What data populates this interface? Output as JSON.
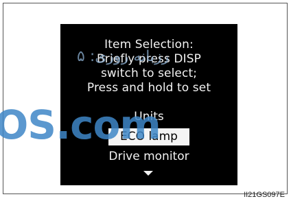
{
  "display": {
    "heading_lines": [
      "Item Selection:",
      "Briefly press DISP",
      "switch to select;",
      "Press and hold to set"
    ],
    "menu_items": [
      "Units",
      "ECO lamp",
      "Drive monitor"
    ],
    "selected_item": "ECO lamp",
    "more_indicator_icon": "triangle-down-icon"
  },
  "figure_code": "II21GS097E",
  "watermark": {
    "text": "رزبانه روزی: ۵",
    "logo": "OS.com"
  },
  "colors": {
    "screen_background": "#000000",
    "text": "#f2f2f2",
    "selection_background": "#f4f4f4",
    "selection_text": "#000000",
    "watermark": "#3f87c7"
  }
}
